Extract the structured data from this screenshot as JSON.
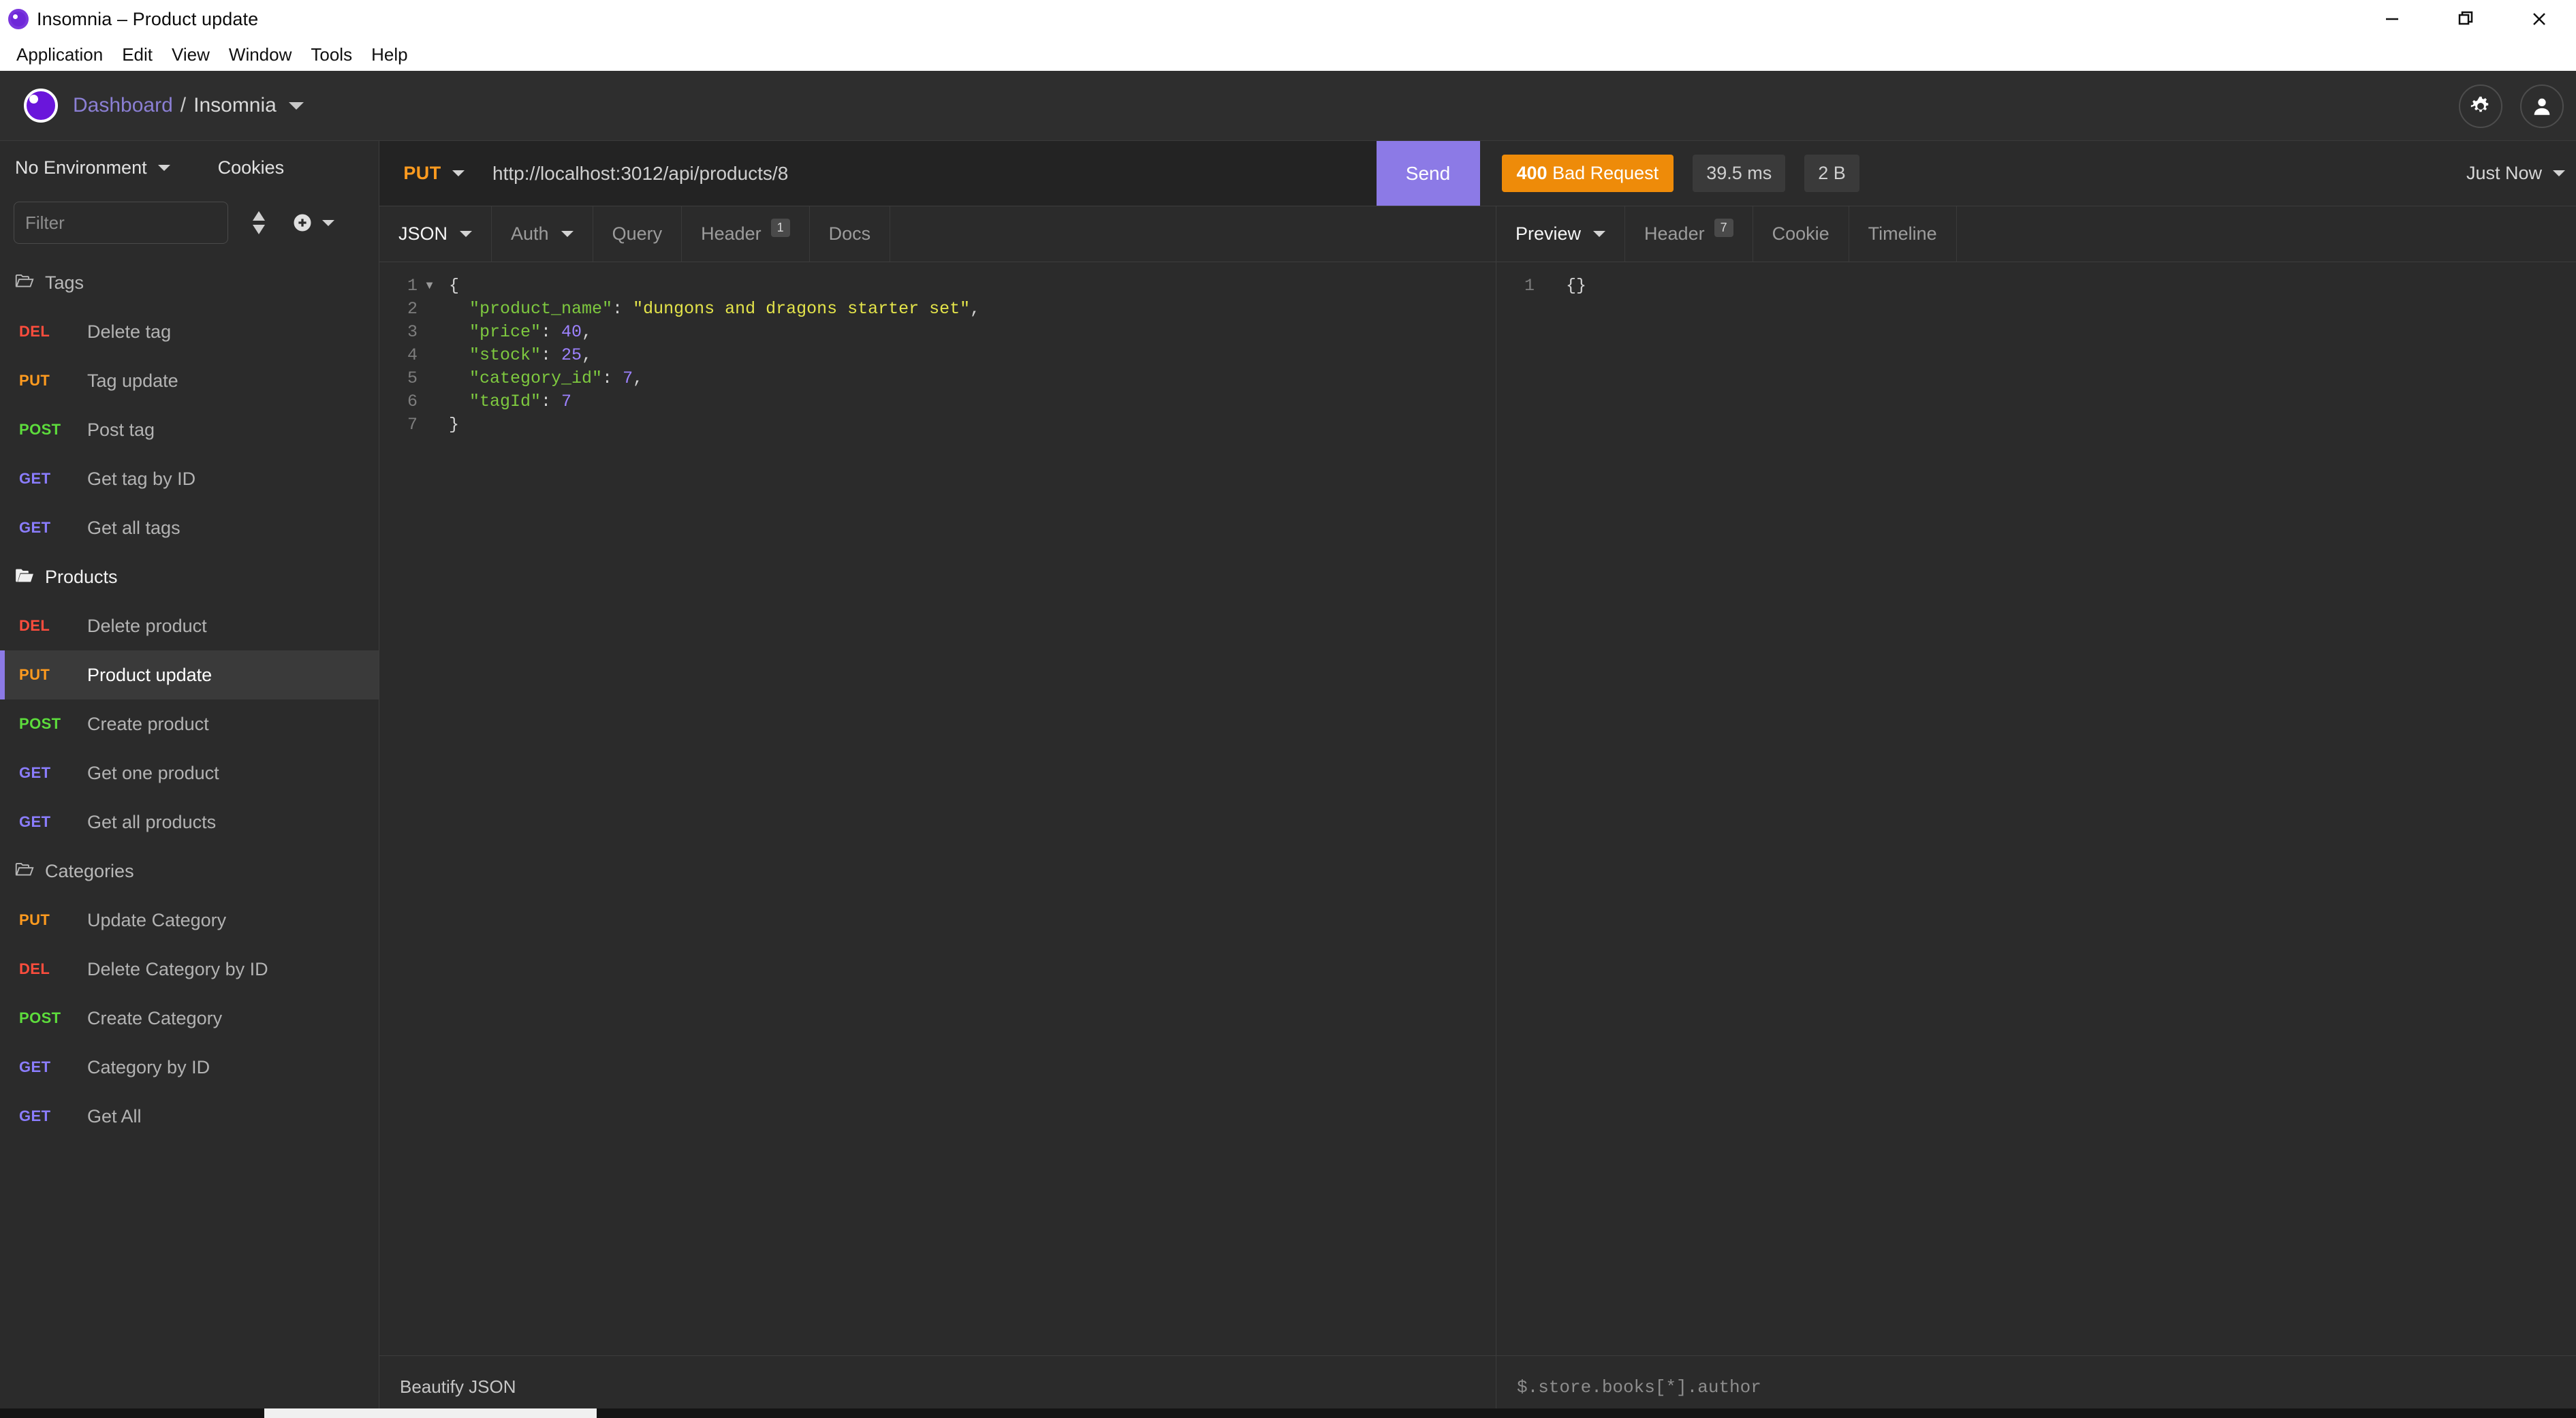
{
  "window": {
    "title": "Insomnia – Product update",
    "controls": {
      "minimize": "minimize-icon",
      "restore": "restore-icon",
      "close": "close-icon"
    }
  },
  "menubar": {
    "items": [
      "Application",
      "Edit",
      "View",
      "Window",
      "Tools",
      "Help"
    ]
  },
  "header": {
    "breadcrumb_root": "Dashboard",
    "breadcrumb_sep": "/",
    "workspace": "Insomnia",
    "settings_icon": "gear-icon",
    "account_icon": "user-icon",
    "logo_icon": "insomnia-logo-icon"
  },
  "sidebar": {
    "environment": "No Environment",
    "cookies_label": "Cookies",
    "filter_placeholder": "Filter",
    "sort_icon": "sort-icon",
    "add_icon": "plus-circle-icon",
    "groups": [
      {
        "name": "Tags",
        "open": false,
        "requests": [
          {
            "method": "DEL",
            "name": "Delete tag",
            "selected": false
          },
          {
            "method": "PUT",
            "name": "Tag update",
            "selected": false
          },
          {
            "method": "POST",
            "name": "Post tag",
            "selected": false
          },
          {
            "method": "GET",
            "name": "Get tag by ID",
            "selected": false
          },
          {
            "method": "GET",
            "name": "Get all tags",
            "selected": false
          }
        ]
      },
      {
        "name": "Products",
        "open": true,
        "requests": [
          {
            "method": "DEL",
            "name": "Delete product",
            "selected": false
          },
          {
            "method": "PUT",
            "name": "Product update",
            "selected": true
          },
          {
            "method": "POST",
            "name": "Create product",
            "selected": false
          },
          {
            "method": "GET",
            "name": "Get one product",
            "selected": false
          },
          {
            "method": "GET",
            "name": "Get all products",
            "selected": false
          }
        ]
      },
      {
        "name": "Categories",
        "open": false,
        "requests": [
          {
            "method": "PUT",
            "name": "Update Category",
            "selected": false
          },
          {
            "method": "DEL",
            "name": "Delete Category by ID",
            "selected": false
          },
          {
            "method": "POST",
            "name": "Create Category",
            "selected": false
          },
          {
            "method": "GET",
            "name": "Category by ID",
            "selected": false
          },
          {
            "method": "GET",
            "name": "Get All",
            "selected": false
          }
        ]
      }
    ]
  },
  "urlbar": {
    "method": "PUT",
    "url": "http://localhost:3012/api/products/8",
    "send_label": "Send"
  },
  "response_meta": {
    "status_code": "400",
    "status_text": "Bad Request",
    "time": "39.5 ms",
    "size": "2 B",
    "timestamp": "Just Now"
  },
  "request_pane": {
    "tabs": [
      {
        "label": "JSON",
        "active": true,
        "caret": true,
        "badge": null
      },
      {
        "label": "Auth",
        "active": false,
        "caret": true,
        "badge": null
      },
      {
        "label": "Query",
        "active": false,
        "caret": false,
        "badge": null
      },
      {
        "label": "Header",
        "active": false,
        "caret": false,
        "badge": "1"
      },
      {
        "label": "Docs",
        "active": false,
        "caret": false,
        "badge": null
      }
    ],
    "body_lines": [
      {
        "n": "1",
        "fold": true,
        "tokens": [
          {
            "t": "p",
            "v": "{"
          }
        ]
      },
      {
        "n": "2",
        "fold": false,
        "tokens": [
          {
            "t": "k",
            "v": "  \"product_name\""
          },
          {
            "t": "p",
            "v": ": "
          },
          {
            "t": "s",
            "v": "\"dungons and dragons starter set\""
          },
          {
            "t": "p",
            "v": ","
          }
        ]
      },
      {
        "n": "3",
        "fold": false,
        "tokens": [
          {
            "t": "k",
            "v": "  \"price\""
          },
          {
            "t": "p",
            "v": ": "
          },
          {
            "t": "n",
            "v": "40"
          },
          {
            "t": "p",
            "v": ","
          }
        ]
      },
      {
        "n": "4",
        "fold": false,
        "tokens": [
          {
            "t": "k",
            "v": "  \"stock\""
          },
          {
            "t": "p",
            "v": ": "
          },
          {
            "t": "n",
            "v": "25"
          },
          {
            "t": "p",
            "v": ","
          }
        ]
      },
      {
        "n": "5",
        "fold": false,
        "tokens": [
          {
            "t": "k",
            "v": "  \"category_id\""
          },
          {
            "t": "p",
            "v": ": "
          },
          {
            "t": "n",
            "v": "7"
          },
          {
            "t": "p",
            "v": ","
          }
        ]
      },
      {
        "n": "6",
        "fold": false,
        "tokens": [
          {
            "t": "k",
            "v": "  \"tagId\""
          },
          {
            "t": "p",
            "v": ": "
          },
          {
            "t": "n",
            "v": "7"
          }
        ]
      },
      {
        "n": "7",
        "fold": false,
        "tokens": [
          {
            "t": "p",
            "v": "}"
          }
        ]
      }
    ],
    "footer_label": "Beautify JSON"
  },
  "response_pane": {
    "tabs": [
      {
        "label": "Preview",
        "active": true,
        "caret": true,
        "badge": null
      },
      {
        "label": "Header",
        "active": false,
        "caret": false,
        "badge": "7"
      },
      {
        "label": "Cookie",
        "active": false,
        "caret": false,
        "badge": null
      },
      {
        "label": "Timeline",
        "active": false,
        "caret": false,
        "badge": null
      }
    ],
    "body_lines": [
      {
        "n": "1",
        "tokens": [
          {
            "t": "p",
            "v": "{}"
          }
        ]
      }
    ],
    "filter_placeholder": "$.store.books[*].author"
  },
  "colors": {
    "accent_purple": "#8c7ae6",
    "status_orange": "#ee8b09",
    "method_put": "#ff9b1f",
    "method_get": "#8b7dff",
    "method_post": "#5ddc3c",
    "method_del": "#ff4d3d",
    "bg": "#2b2b2b"
  }
}
